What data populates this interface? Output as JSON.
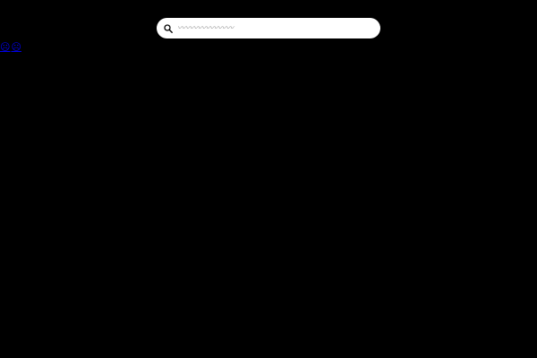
{
  "search": {
    "placeholder": "〰〰〰〰〰〰〰",
    "icon": "search-icon"
  },
  "links": [
    {
      "glyph": "☹",
      "icon": "sad-face-icon"
    },
    {
      "glyph": "☹",
      "icon": "sad-face-icon"
    }
  ],
  "colors": {
    "background": "#000000",
    "search_bar": "#ffffff",
    "link": "#0000ee"
  }
}
